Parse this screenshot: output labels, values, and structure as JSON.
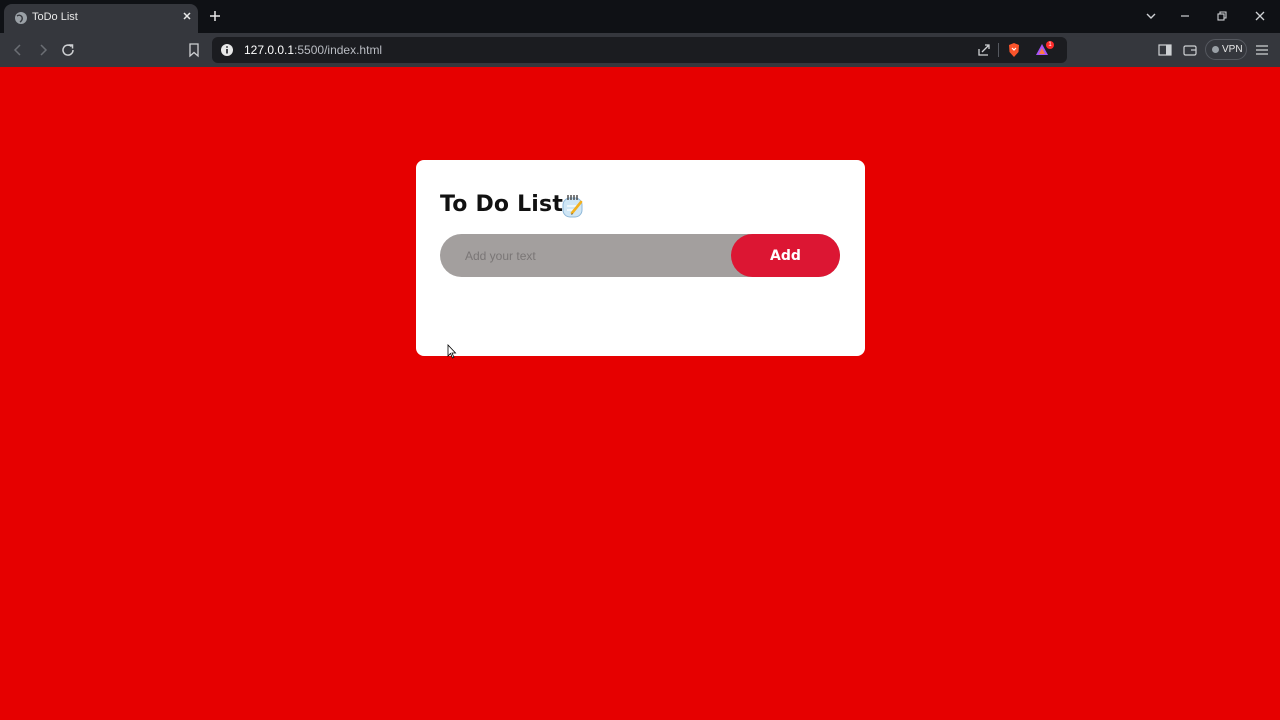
{
  "browser": {
    "tab": {
      "title": "ToDo List"
    },
    "address": {
      "host": "127.0.0.1",
      "path": ":5500/index.html"
    },
    "vpn_label": "VPN",
    "rewards_badge_count": "1"
  },
  "app": {
    "title": "To Do List",
    "title_icon": "notepad-icon",
    "input": {
      "placeholder": "Add your text",
      "value": ""
    },
    "add_button_label": "Add"
  },
  "colors": {
    "page_background": "#e60000",
    "card_background": "#ffffff",
    "input_background": "#a39f9e",
    "button_background": "#dc1633"
  }
}
